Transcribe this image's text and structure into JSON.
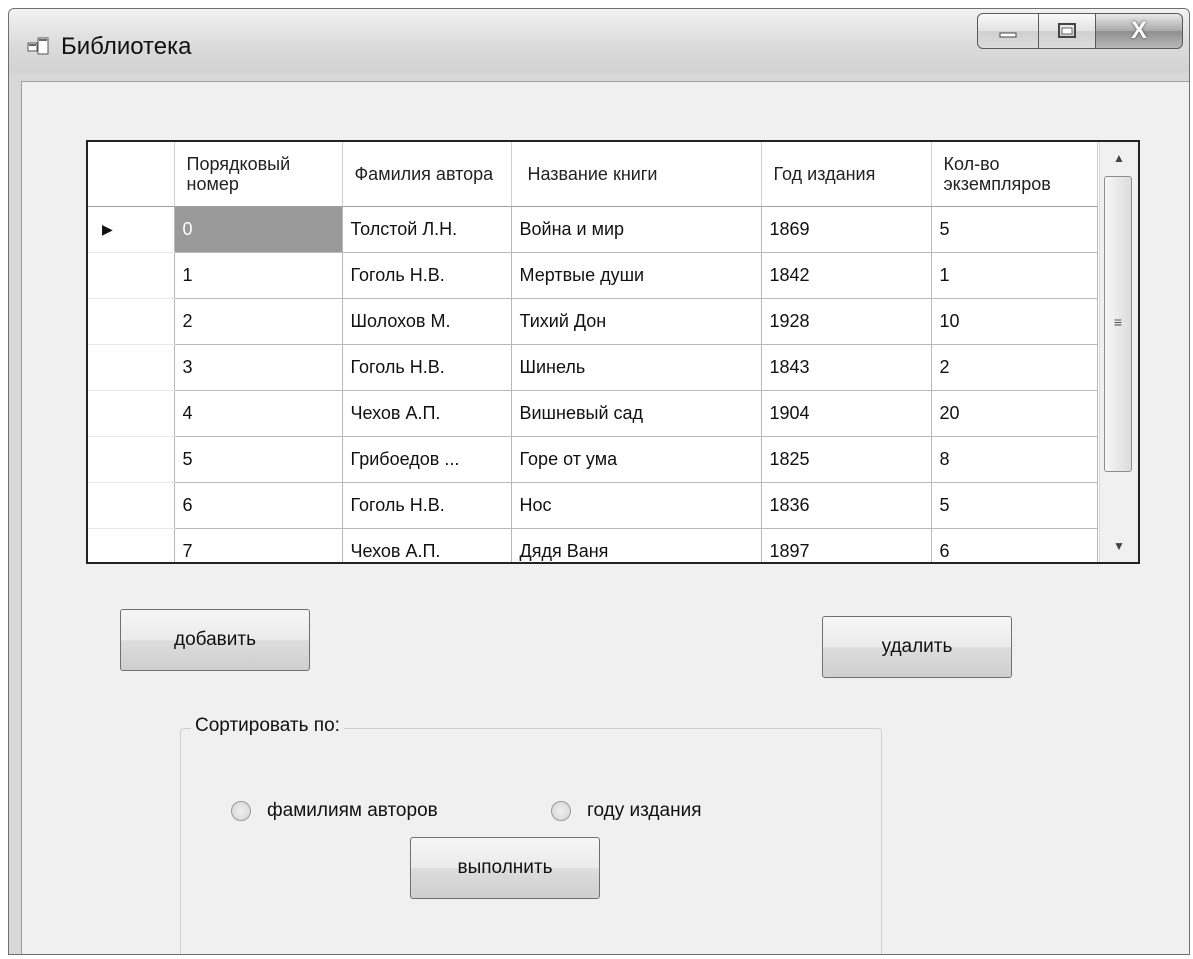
{
  "window": {
    "title": "Библиотека",
    "close_glyph": "X",
    "accent_close": "#8f8f8f",
    "app_icon": "window-app-icon"
  },
  "grid": {
    "columns": [
      {
        "label": "Порядковый номер"
      },
      {
        "label": "Фамилия автора"
      },
      {
        "label": "Название книги"
      },
      {
        "label": "Год издания"
      },
      {
        "label": "Кол-во экземпляров"
      }
    ],
    "rows": [
      {
        "current": true,
        "cells": [
          "0",
          "Толстой Л.Н.",
          "Война и мир",
          "1869",
          "5"
        ]
      },
      {
        "current": false,
        "cells": [
          "1",
          "Гоголь Н.В.",
          "Мертвые души",
          "1842",
          "1"
        ]
      },
      {
        "current": false,
        "cells": [
          "2",
          "Шолохов  М.",
          "Тихий Дон",
          "1928",
          "10"
        ]
      },
      {
        "current": false,
        "cells": [
          "3",
          "Гоголь Н.В.",
          "Шинель",
          "1843",
          "2"
        ]
      },
      {
        "current": false,
        "cells": [
          "4",
          "Чехов А.П.",
          "Вишневый сад",
          "1904",
          "20"
        ]
      },
      {
        "current": false,
        "cells": [
          "5",
          "Грибоедов ...",
          "Горе от ума",
          "1825",
          "8"
        ]
      },
      {
        "current": false,
        "cells": [
          "6",
          "Гоголь Н.В.",
          "Нос",
          "1836",
          "5"
        ]
      },
      {
        "current": false,
        "cells": [
          "7",
          "Чехов А.П.",
          "Дядя Ваня",
          "1897",
          "6"
        ]
      }
    ],
    "current_row_marker": "▶",
    "selected_cell_color": "#999999"
  },
  "buttons": {
    "add_label": "добавить",
    "delete_label": "удалить",
    "run_label": "выполнить"
  },
  "sort": {
    "legend": "Сортировать по:",
    "option_author": "фамилиям авторов",
    "option_year": "году издания"
  }
}
